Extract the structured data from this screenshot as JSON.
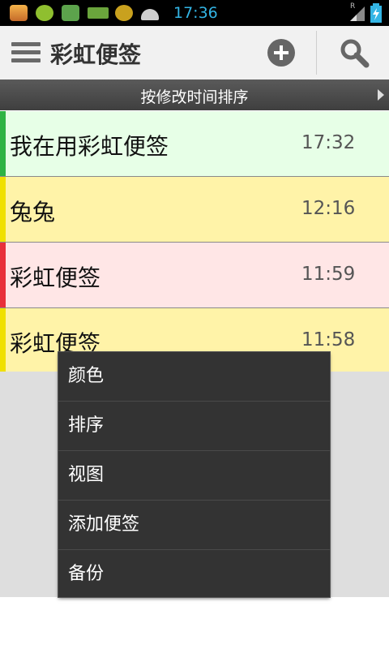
{
  "status_bar": {
    "time": "17:36",
    "colors": {
      "time": "#33b5e5"
    },
    "notification_icons": [
      "app-icon",
      "cat-icon",
      "bug-icon",
      "battery-saver-icon",
      "android-logo-icon",
      "android-head-icon"
    ],
    "status_icons": [
      "signal-icon",
      "charging-battery-icon"
    ],
    "signal_label": "R"
  },
  "action_bar": {
    "title": "彩虹便签",
    "icons": [
      "menu-icon",
      "add-icon",
      "search-icon"
    ]
  },
  "sort_bar": {
    "label": "按修改时间排序"
  },
  "notes": [
    {
      "title": "我在用彩虹便签",
      "time": "17:32",
      "bg": "#e7ffe7",
      "accent": "#2fb344"
    },
    {
      "title": "兔兔",
      "time": "12:16",
      "bg": "#fff3a8",
      "accent": "#f0e000"
    },
    {
      "title": "彩虹便签",
      "time": "11:59",
      "bg": "#ffe6e6",
      "accent": "#e8303a"
    },
    {
      "title": "彩虹便签",
      "time": "11:58",
      "bg": "#fff3a8",
      "accent": "#f0e000"
    }
  ],
  "menu": {
    "items": [
      "颜色",
      "排序",
      "视图",
      "添加便签",
      "备份"
    ]
  }
}
